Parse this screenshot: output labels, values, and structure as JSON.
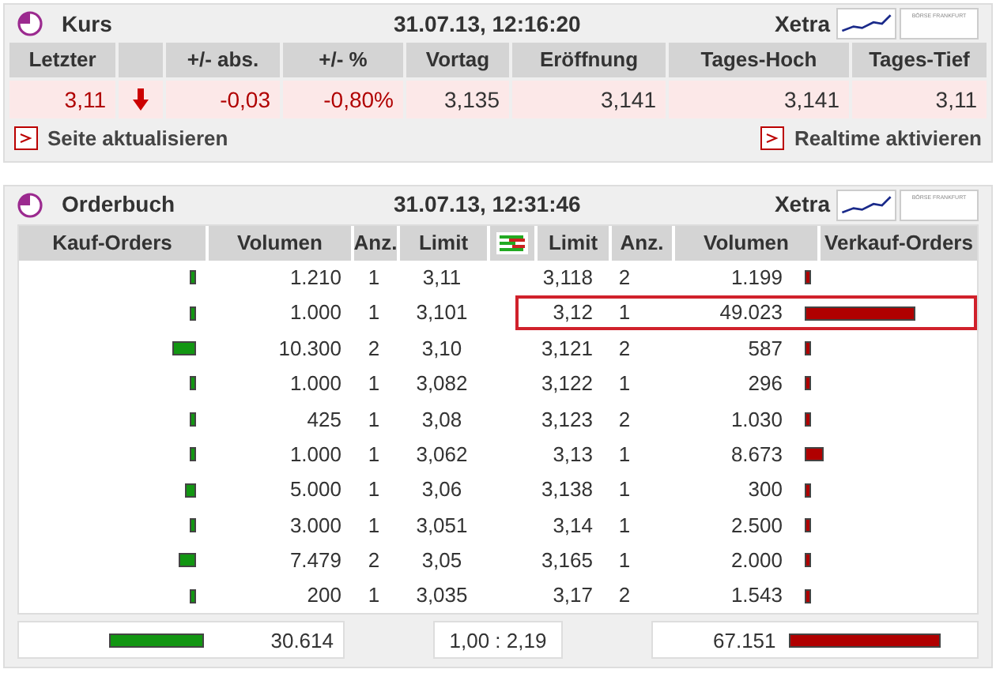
{
  "kurs": {
    "title": "Kurs",
    "timestamp": "31.07.13, 12:16:20",
    "exchange": "Xetra",
    "logo_text": "BÖRSE FRANKFURT",
    "columns": [
      "Letzter",
      "",
      "+/- abs.",
      "+/- %",
      "Vortag",
      "Eröffnung",
      "Tages-Hoch",
      "Tages-Tief"
    ],
    "row": {
      "letzter": "3,11",
      "falling": true,
      "abs": "-0,03",
      "pct": "-0,80%",
      "vortag": "3,135",
      "eroeffnung": "3,141",
      "hoch": "3,141",
      "tief": "3,11"
    },
    "links": [
      "Seite aktualisieren",
      "Realtime aktivieren"
    ]
  },
  "orderbuch": {
    "title": "Orderbuch",
    "timestamp": "31.07.13, 12:31:46",
    "exchange": "Xetra",
    "logo_text": "BÖRSE FRANKFURT",
    "columns": [
      "Kauf-Orders",
      "Volumen",
      "Anz.",
      "Limit",
      "Limit",
      "Anz.",
      "Volumen",
      "Verkauf-Orders"
    ],
    "rows": [
      {
        "buy_volume": "1.210",
        "buy_count": "1",
        "buy_limit": "3,11",
        "sell_limit": "3,118",
        "sell_count": "2",
        "sell_volume": "1.199",
        "selected": false
      },
      {
        "buy_volume": "1.000",
        "buy_count": "1",
        "buy_limit": "3,101",
        "sell_limit": "3,12",
        "sell_count": "1",
        "sell_volume": "49.023",
        "selected": true
      },
      {
        "buy_volume": "10.300",
        "buy_count": "2",
        "buy_limit": "3,10",
        "sell_limit": "3,121",
        "sell_count": "2",
        "sell_volume": "587",
        "selected": false
      },
      {
        "buy_volume": "1.000",
        "buy_count": "1",
        "buy_limit": "3,082",
        "sell_limit": "3,122",
        "sell_count": "1",
        "sell_volume": "296",
        "selected": false
      },
      {
        "buy_volume": "425",
        "buy_count": "1",
        "buy_limit": "3,08",
        "sell_limit": "3,123",
        "sell_count": "2",
        "sell_volume": "1.030",
        "selected": false
      },
      {
        "buy_volume": "1.000",
        "buy_count": "1",
        "buy_limit": "3,062",
        "sell_limit": "3,13",
        "sell_count": "1",
        "sell_volume": "8.673",
        "selected": false
      },
      {
        "buy_volume": "5.000",
        "buy_count": "1",
        "buy_limit": "3,06",
        "sell_limit": "3,138",
        "sell_count": "1",
        "sell_volume": "300",
        "selected": false
      },
      {
        "buy_volume": "3.000",
        "buy_count": "1",
        "buy_limit": "3,051",
        "sell_limit": "3,14",
        "sell_count": "1",
        "sell_volume": "2.500",
        "selected": false
      },
      {
        "buy_volume": "7.479",
        "buy_count": "2",
        "buy_limit": "3,05",
        "sell_limit": "3,165",
        "sell_count": "1",
        "sell_volume": "2.000",
        "selected": false
      },
      {
        "buy_volume": "200",
        "buy_count": "1",
        "buy_limit": "3,035",
        "sell_limit": "3,17",
        "sell_count": "2",
        "sell_volume": "1.543",
        "selected": false
      }
    ],
    "totals": {
      "buy_total": "30.614",
      "ratio": "1,00 : 2,19",
      "sell_total": "67.151"
    }
  }
}
